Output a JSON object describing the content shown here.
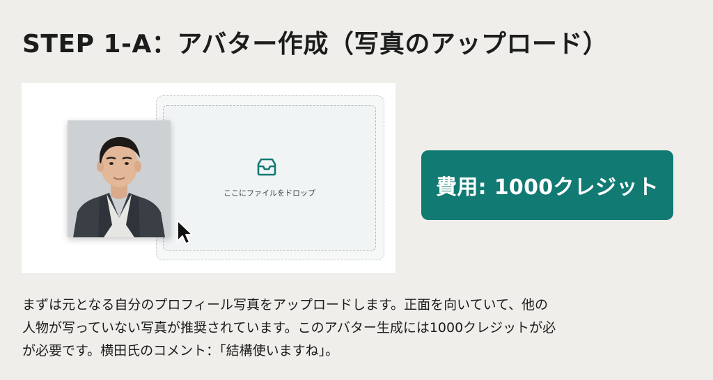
{
  "slide": {
    "title": "STEP 1-A：アバター作成（写真のアップロード）"
  },
  "upload_panel": {
    "drop_label": "ここにファイルをドロップ",
    "icon": "inbox-tray-icon",
    "photo": "portrait-photo",
    "accent_color": "#107a73"
  },
  "cost": {
    "label": "費用: 1000クレジット",
    "color": "#107a73"
  },
  "description": {
    "lines": [
      "まずは元となる自分のプロフィール写真をアップロードします。正面を向いていて、他の",
      "人物が写っていない写真が推奨されています。このアバター生成には1000クレジットが必",
      "が必要です。横田氏のコメント：「結構使いますね」。"
    ]
  }
}
